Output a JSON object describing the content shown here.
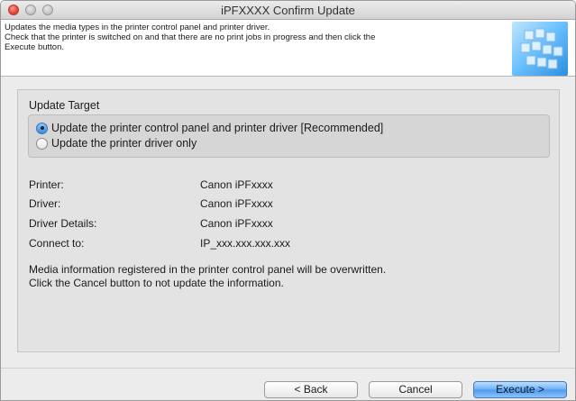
{
  "window": {
    "title": "iPFXXXX  Confirm Update"
  },
  "header": {
    "line1": "Updates the media types in the printer control panel and printer driver.",
    "line2": "Check that the printer is switched on and that there are no print jobs in progress and then click the",
    "line3": "Execute button.",
    "art_icon": "printer-media-graphic"
  },
  "update_target": {
    "title": "Update Target",
    "options": [
      {
        "label": "Update the printer control panel and printer driver [Recommended]",
        "selected": true
      },
      {
        "label": "Update the printer driver only",
        "selected": false
      }
    ]
  },
  "info": [
    {
      "label": "Printer:",
      "value": "Canon iPFxxxx"
    },
    {
      "label": "Driver:",
      "value": "Canon iPFxxxx"
    },
    {
      "label": "Driver Details:",
      "value": "Canon iPFxxxx"
    },
    {
      "label": "Connect to:",
      "value": "IP_xxx.xxx.xxx.xxx"
    }
  ],
  "note": {
    "line1": "Media information registered in the printer control panel will be overwritten.",
    "line2": "Click the Cancel button to not update the information."
  },
  "buttons": {
    "back": "< Back",
    "cancel": "Cancel",
    "execute": "Execute >"
  },
  "colors": {
    "accent": "#4e98ec",
    "panel": "#e3e3e3"
  }
}
